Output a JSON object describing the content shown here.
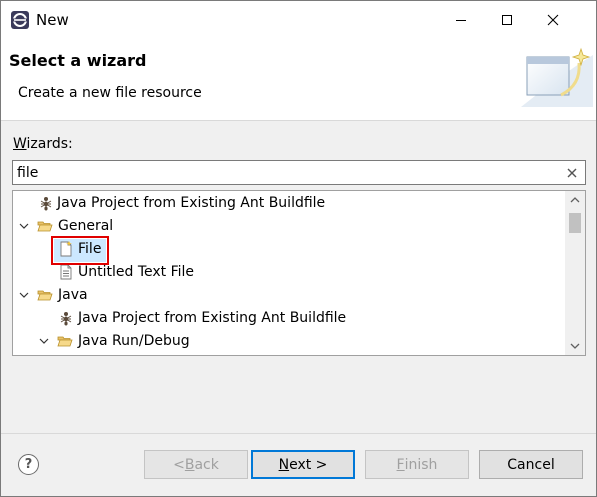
{
  "window": {
    "title": "New"
  },
  "banner": {
    "title": "Select a wizard",
    "description": "Create a new file resource"
  },
  "wizards": {
    "label_prefix": "",
    "label_accel": "W",
    "label_rest": "izards:",
    "search_value": "file"
  },
  "tree": {
    "items": [
      {
        "label": "Java Project from Existing Ant Buildfile",
        "icon": "ant-icon",
        "expanded": null
      },
      {
        "label": "General",
        "icon": "folder-icon",
        "expanded": true
      },
      {
        "label": "File",
        "icon": "file-icon",
        "expanded": null,
        "selected": true
      },
      {
        "label": "Untitled Text File",
        "icon": "text-file-icon",
        "expanded": null
      },
      {
        "label": "Java",
        "icon": "folder-icon",
        "expanded": true
      },
      {
        "label": "Java Project from Existing Ant Buildfile",
        "icon": "ant-icon",
        "expanded": null
      },
      {
        "label": "Java Run/Debug",
        "icon": "folder-icon",
        "expanded": true
      }
    ]
  },
  "buttons": {
    "back": {
      "prefix": "< ",
      "accel": "B",
      "rest": "ack"
    },
    "next": {
      "prefix": "",
      "accel": "N",
      "rest": "ext >"
    },
    "finish": {
      "prefix": "",
      "accel": "F",
      "rest": "inish"
    },
    "cancel": {
      "label": "Cancel"
    }
  },
  "colors": {
    "selection_bg": "#cce8ff",
    "highlight_border": "#e00000",
    "default_button_border": "#0078d7"
  }
}
